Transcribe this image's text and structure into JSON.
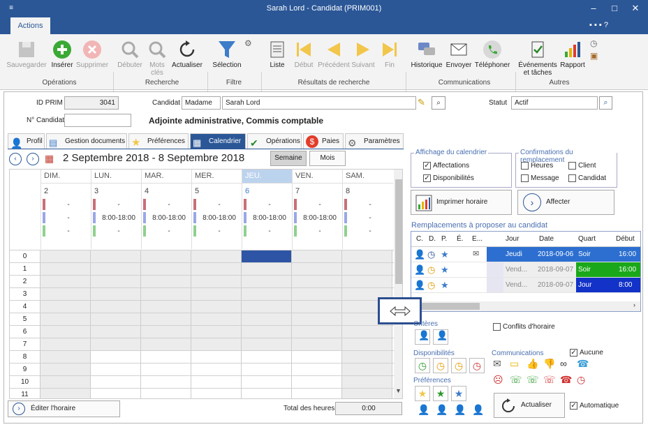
{
  "window": {
    "title": "Sarah Lord - Candidat (PRIM001)"
  },
  "ribbon": {
    "tab": "Actions",
    "buttons": {
      "save": "Sauvegarder",
      "insert": "Insérer",
      "delete": "Supprimer",
      "debuter": "Débuter",
      "mots": "Mots clés",
      "actualiser": "Actualiser",
      "selection": "Sélection",
      "liste": "Liste",
      "debut": "Début",
      "precedent": "Précédent",
      "suivant": "Suivant",
      "fin": "Fin",
      "historique": "Historique",
      "envoyer": "Envoyer",
      "telephoner": "Téléphoner",
      "evenements": "Événements et tâches",
      "rapport": "Rapport"
    },
    "groups": {
      "operations": "Opérations",
      "recherche": "Recherche",
      "filtre": "Filtre",
      "resultats": "Résultats de recherche",
      "communications": "Communications",
      "autres": "Autres"
    }
  },
  "form": {
    "id_label": "ID PRIM",
    "id_value": "3041",
    "candidat_label": "Candidat",
    "civility": "Madame",
    "name": "Sarah Lord",
    "statut_label": "Statut",
    "statut_value": "Actif",
    "num_label": "N° Candidat",
    "num_value": "",
    "position": "Adjointe administrative, Commis comptable"
  },
  "tabs": [
    "Profil",
    "Gestion documents",
    "Préférences",
    "Calendrier",
    "Opérations",
    "Paies",
    "Paramètres"
  ],
  "calendar": {
    "range": "2 Septembre 2018 - 8 Septembre 2018",
    "view_week": "Semaine",
    "view_month": "Mois",
    "days": [
      {
        "name": "DIM.",
        "num": "2",
        "line1": "-",
        "line2": "-",
        "line3": "-"
      },
      {
        "name": "LUN.",
        "num": "3",
        "line1": "-",
        "line2": "8:00-18:00",
        "line3": "-"
      },
      {
        "name": "MAR.",
        "num": "4",
        "line1": "-",
        "line2": "8:00-18:00",
        "line3": "-"
      },
      {
        "name": "MER.",
        "num": "5",
        "line1": "-",
        "line2": "8:00-18:00",
        "line3": "-"
      },
      {
        "name": "JEU.",
        "num": "6",
        "line1": "-",
        "line2": "8:00-18:00",
        "line3": "-"
      },
      {
        "name": "VEN.",
        "num": "7",
        "line1": "-",
        "line2": "8:00-18:00",
        "line3": "-"
      },
      {
        "name": "SAM.",
        "num": "8",
        "line1": "-",
        "line2": "-",
        "line3": "-"
      }
    ],
    "hours": [
      "0",
      "1",
      "2",
      "3",
      "4",
      "5",
      "6",
      "7",
      "8",
      "9",
      "10",
      "11"
    ],
    "edit_button": "Éditer l'horaire",
    "total_label": "Total des heures",
    "total_value": "0:00"
  },
  "affichage": {
    "legend": "Affichage du calendrier",
    "affectations": "Affectations",
    "disponibilites": "Disponibilités",
    "print": "Imprimer horaire"
  },
  "confirmations": {
    "legend": "Confirmations du remplacement",
    "heures": "Heures",
    "client": "Client",
    "message": "Message",
    "candidat": "Candidat",
    "affecter": "Affecter"
  },
  "remplacements": {
    "legend": "Remplacements à proposer au candidat",
    "columns": [
      "C.",
      "D.",
      "P.",
      "É.",
      "E...",
      "Jour",
      "Date",
      "Quart",
      "Début"
    ],
    "rows": [
      {
        "jour": "Jeudi",
        "date": "2018-09-06",
        "quart": "Soir",
        "debut": "16:00",
        "color": "#2c6fd0"
      },
      {
        "jour": "Vend...",
        "date": "2018-09-07",
        "quart": "Soir",
        "debut": "16:00",
        "color": "#1aa81a"
      },
      {
        "jour": "Vend...",
        "date": "2018-09-07",
        "quart": "Jour",
        "debut": "8:00",
        "color": "#1232c8"
      }
    ]
  },
  "filters": {
    "criteres": "Critères",
    "conflits": "Conflits d'horaire",
    "disponibilites": "Disponibilités",
    "communications": "Communications",
    "aucune": "Aucune",
    "preferences": "Préférences",
    "actualiser": "Actualiser",
    "automatique": "Automatique"
  },
  "colors": {
    "title": "#2b5797",
    "accent": "#2b5797",
    "today": "#bcd3ee"
  }
}
